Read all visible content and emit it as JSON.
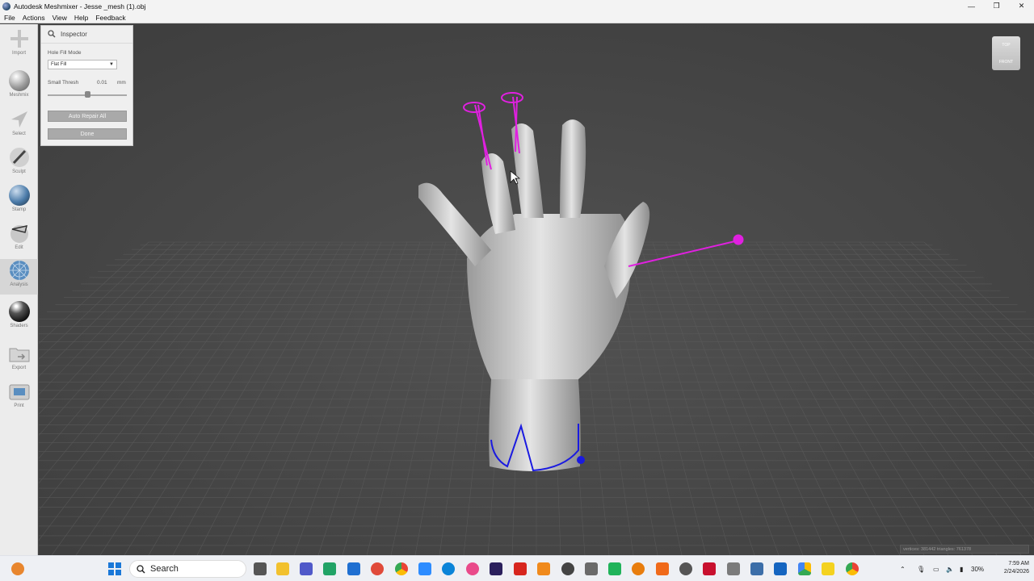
{
  "window": {
    "title": "Autodesk Meshmixer - Jesse _mesh (1).obj",
    "controls": {
      "minimize": "—",
      "maximize": "❐",
      "close": "✕"
    }
  },
  "menu": [
    "File",
    "Actions",
    "View",
    "Help",
    "Feedback"
  ],
  "toolbar": [
    {
      "label": "Import",
      "icon": "plus-icon"
    },
    {
      "label": "Meshmix",
      "icon": "meshmix-icon"
    },
    {
      "label": "Select",
      "icon": "select-arrow-icon"
    },
    {
      "label": "Sculpt",
      "icon": "brush-icon"
    },
    {
      "label": "Stamp",
      "icon": "stamp-icon"
    },
    {
      "label": "Edit",
      "icon": "edit-icon"
    },
    {
      "label": "Analysis",
      "icon": "analysis-icon",
      "active": true
    },
    {
      "label": "Shaders",
      "icon": "shader-ball-icon"
    },
    {
      "label": "Export",
      "icon": "folder-export-icon"
    },
    {
      "label": "Print",
      "icon": "printer-icon"
    }
  ],
  "inspector": {
    "title": "Inspector",
    "hole_fill_label": "Hole Fill Mode",
    "hole_fill_value": "Flat Fill",
    "small_thresh_label": "Small Thresh",
    "small_thresh_value": "0.01",
    "small_thresh_unit": "mm",
    "auto_repair_label": "Auto Repair All",
    "done_label": "Done"
  },
  "viewcube": {
    "top": "TOP",
    "front": "FRONT"
  },
  "stats": "vertices: 381442 triangles: 761378",
  "colors": {
    "error_marker": "#e020e0",
    "boundary": "#1a1ae0",
    "viewport_bg": "#474747"
  },
  "taskbar": {
    "search_placeholder": "Search",
    "battery": "30%",
    "time": "7:59 AM",
    "date": "2/24/2026"
  }
}
